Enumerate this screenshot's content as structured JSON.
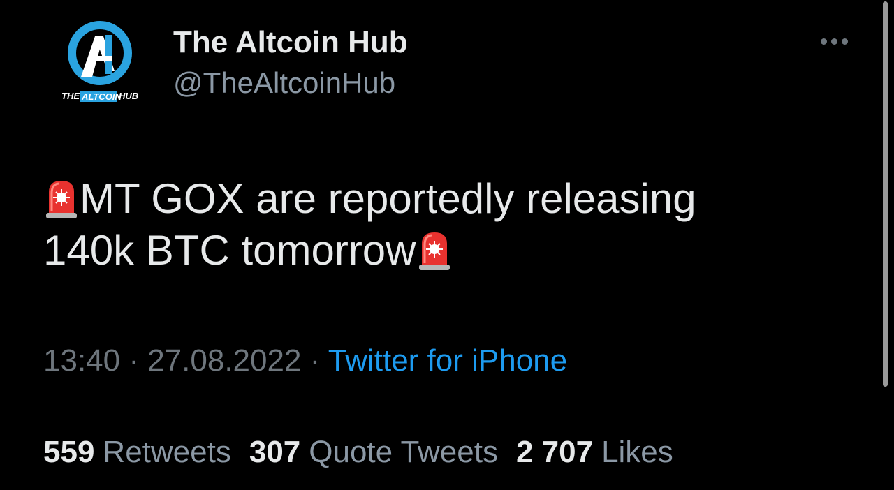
{
  "author": {
    "display_name": "The Altcoin Hub",
    "handle": "@TheAltcoinHub",
    "avatar_text_left": "THE",
    "avatar_text_highlight": "ALTCOIN",
    "avatar_text_right": "HUB"
  },
  "tweet": {
    "line1": "MT GOX are reportedly releasing",
    "line2": "140k BTC tomorrow",
    "leading_icon": "police-siren-emoji",
    "trailing_icon": "police-siren-emoji"
  },
  "meta": {
    "time": "13:40",
    "separator": " · ",
    "date": "27.08.2022",
    "source": "Twitter for iPhone"
  },
  "stats": {
    "retweets_count": "559",
    "retweets_label": "Retweets",
    "quotes_count": "307",
    "quotes_label": "Quote Tweets",
    "likes_count": "2 707",
    "likes_label": "Likes"
  },
  "colors": {
    "background": "#000000",
    "text_primary": "#e7e9ea",
    "text_secondary": "#8b98a5",
    "link": "#1d9bf0",
    "divider": "#2f3336",
    "avatar_ring": "#2aa3e0"
  },
  "icons": {
    "more": "more-horizontal-icon"
  }
}
